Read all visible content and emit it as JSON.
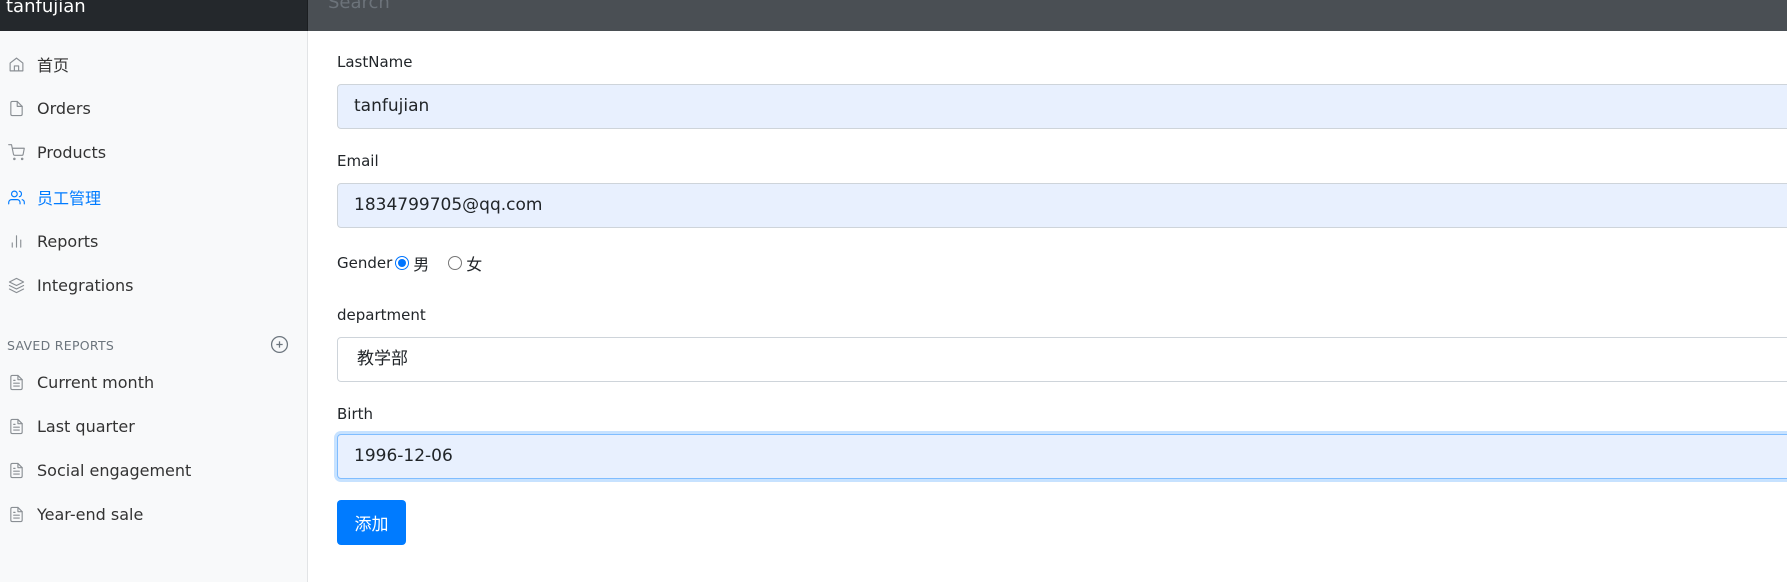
{
  "navbar": {
    "brand": "tanfujian",
    "search_placeholder": "Search"
  },
  "sidebar": {
    "items": [
      {
        "label": "首页",
        "icon": "home-icon"
      },
      {
        "label": "Orders",
        "icon": "file-icon"
      },
      {
        "label": "Products",
        "icon": "shopping-cart-icon"
      },
      {
        "label": "员工管理",
        "icon": "users-icon",
        "active": true
      },
      {
        "label": "Reports",
        "icon": "bar-chart-icon"
      },
      {
        "label": "Integrations",
        "icon": "layers-icon"
      }
    ],
    "saved_reports_heading": "SAVED REPORTS",
    "saved_reports": [
      {
        "label": "Current month",
        "icon": "file-text-icon"
      },
      {
        "label": "Last quarter",
        "icon": "file-text-icon"
      },
      {
        "label": "Social engagement",
        "icon": "file-text-icon"
      },
      {
        "label": "Year-end sale",
        "icon": "file-text-icon"
      }
    ]
  },
  "form": {
    "lastname_label": "LastName",
    "lastname_value": "tanfujian",
    "email_label": "Email",
    "email_value": "1834799705@qq.com",
    "gender_label": "Gender",
    "gender_options": [
      {
        "label": "男",
        "checked": true
      },
      {
        "label": "女",
        "checked": false
      }
    ],
    "department_label": "department",
    "department_value": "教学部",
    "birth_label": "Birth",
    "birth_value": "1996-12-06",
    "submit_label": "添加"
  },
  "colors": {
    "accent": "#007bff",
    "navbar": "#343a40",
    "sidebar_bg": "#f8f9fa",
    "autofill_bg": "#e8f0fe"
  }
}
